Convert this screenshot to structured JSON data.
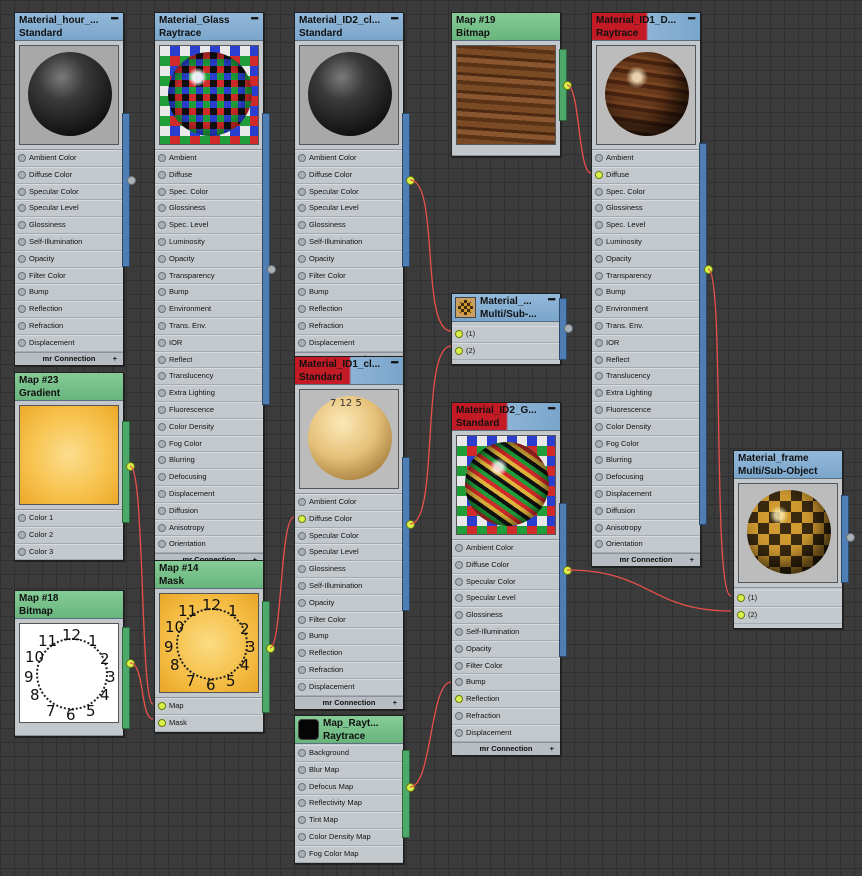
{
  "nodes": {
    "hour": {
      "title": "Material_hour_...",
      "subtitle": "Standard",
      "slots": [
        "Ambient Color",
        "Diffuse Color",
        "Specular Color",
        "Specular Level",
        "Glossiness",
        "Self-Illumination",
        "Opacity",
        "Filter Color",
        "Bump",
        "Reflection",
        "Refraction",
        "Displacement"
      ],
      "footer": "mr Connection"
    },
    "glass": {
      "title": "Material_Glass",
      "subtitle": "Raytrace",
      "slots": [
        "Ambient",
        "Diffuse",
        "Spec. Color",
        "Glossiness",
        "Spec. Level",
        "Luminosity",
        "Opacity",
        "Transparency",
        "Bump",
        "Environment",
        "Trans. Env.",
        "IOR",
        "Reflect",
        "Translucency",
        "Extra Lighting",
        "Fluorescence",
        "Color Density",
        "Fog Color",
        "Blurring",
        "Defocusing",
        "Displacement",
        "Diffusion",
        "Anisotropy",
        "Orientation"
      ],
      "footer": "mr Connection"
    },
    "id2cl": {
      "title": "Material_ID2_cl...",
      "subtitle": "Standard",
      "slots": [
        "Ambient Color",
        "Diffuse Color",
        "Specular Color",
        "Specular Level",
        "Glossiness",
        "Self-Illumination",
        "Opacity",
        "Filter Color",
        "Bump",
        "Reflection",
        "Refraction",
        "Displacement"
      ],
      "footer": "mr Connection"
    },
    "map19": {
      "title": "Map #19",
      "subtitle": "Bitmap"
    },
    "id1d": {
      "title": "Material_ID1_D...",
      "subtitle": "Raytrace",
      "slots": [
        "Ambient",
        "Diffuse",
        "Spec. Color",
        "Glossiness",
        "Spec. Level",
        "Luminosity",
        "Opacity",
        "Transparency",
        "Bump",
        "Environment",
        "Trans. Env.",
        "IOR",
        "Reflect",
        "Translucency",
        "Extra Lighting",
        "Fluorescence",
        "Color Density",
        "Fog Color",
        "Blurring",
        "Defocusing",
        "Displacement",
        "Diffusion",
        "Anisotropy",
        "Orientation"
      ],
      "footer": "mr Connection"
    },
    "multi": {
      "title": "Material_...",
      "subtitle": "Multi/Sub-...",
      "slots": [
        "(1)",
        "(2)"
      ]
    },
    "map23": {
      "title": "Map #23",
      "subtitle": "Gradient",
      "slots": [
        "Color 1",
        "Color 2",
        "Color 3"
      ]
    },
    "id1cl": {
      "title": "Material_ID1_cl...",
      "subtitle": "Standard",
      "slots": [
        "Ambient Color",
        "Diffuse Color",
        "Specular Color",
        "Specular Level",
        "Glossiness",
        "Self-Illumination",
        "Opacity",
        "Filter Color",
        "Bump",
        "Reflection",
        "Refraction",
        "Displacement"
      ],
      "footer": "mr Connection"
    },
    "id2g": {
      "title": "Material_ID2_G...",
      "subtitle": "Standard",
      "slots": [
        "Ambient Color",
        "Diffuse Color",
        "Specular Color",
        "Specular Level",
        "Glossiness",
        "Self-Illumination",
        "Opacity",
        "Filter Color",
        "Bump",
        "Reflection",
        "Refraction",
        "Displacement"
      ],
      "footer": "mr Connection"
    },
    "frame": {
      "title": "Material_frame",
      "subtitle": "Multi/Sub-Object",
      "slots": [
        "(1)",
        "(2)"
      ]
    },
    "map18": {
      "title": "Map #18",
      "subtitle": "Bitmap"
    },
    "map14": {
      "title": "Map #14",
      "subtitle": "Mask",
      "slots": [
        "Map",
        "Mask"
      ]
    },
    "rayt": {
      "title": "Map_Rayt...",
      "subtitle": "Raytrace",
      "slots": [
        "Background",
        "Blur Map",
        "Defocus Map",
        "Reflectivity Map",
        "Tint Map",
        "Color Density Map",
        "Fog Color Map"
      ]
    }
  },
  "clock_numbers": [
    "12",
    "1",
    "2",
    "3",
    "4",
    "5",
    "6",
    "7",
    "8",
    "9",
    "10",
    "11"
  ],
  "thumb_clock_text": "7 12 5",
  "colors": {
    "wire": "#e8504a",
    "socket_active": "#d9f24a",
    "material_header": "#7aa5cb",
    "map_header": "#68b57c",
    "active_header": "#c21b25"
  }
}
